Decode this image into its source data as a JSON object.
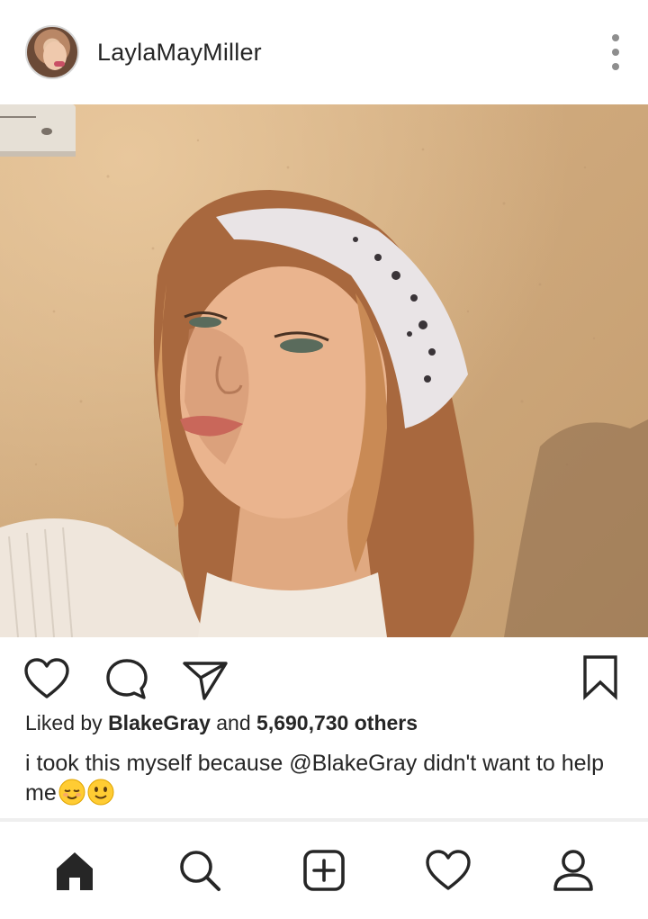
{
  "post": {
    "username": "LaylaMayMiller",
    "photo_alt": "",
    "likes": {
      "prefix": "Liked by ",
      "liker": "BlakeGray",
      "middle": " and ",
      "count": "5,690,730 others"
    },
    "caption": {
      "text": "i took this myself because @BlakeGray didn't want to help me",
      "emojis": [
        "relieved-face",
        "slightly-smiling-face"
      ]
    }
  },
  "icons": {
    "more": "more-vertical-icon",
    "like": "heart-icon",
    "comment": "comment-icon",
    "share": "send-icon",
    "save": "bookmark-icon"
  },
  "nav": {
    "items": [
      {
        "icon": "home-icon",
        "active": true
      },
      {
        "icon": "search-icon",
        "active": false
      },
      {
        "icon": "add-post-icon",
        "active": false
      },
      {
        "icon": "activity-heart-icon",
        "active": false
      },
      {
        "icon": "profile-icon",
        "active": false
      }
    ]
  },
  "colors": {
    "text": "#262626",
    "muted": "#8e8e8e",
    "emoji": "#ffcc33"
  }
}
